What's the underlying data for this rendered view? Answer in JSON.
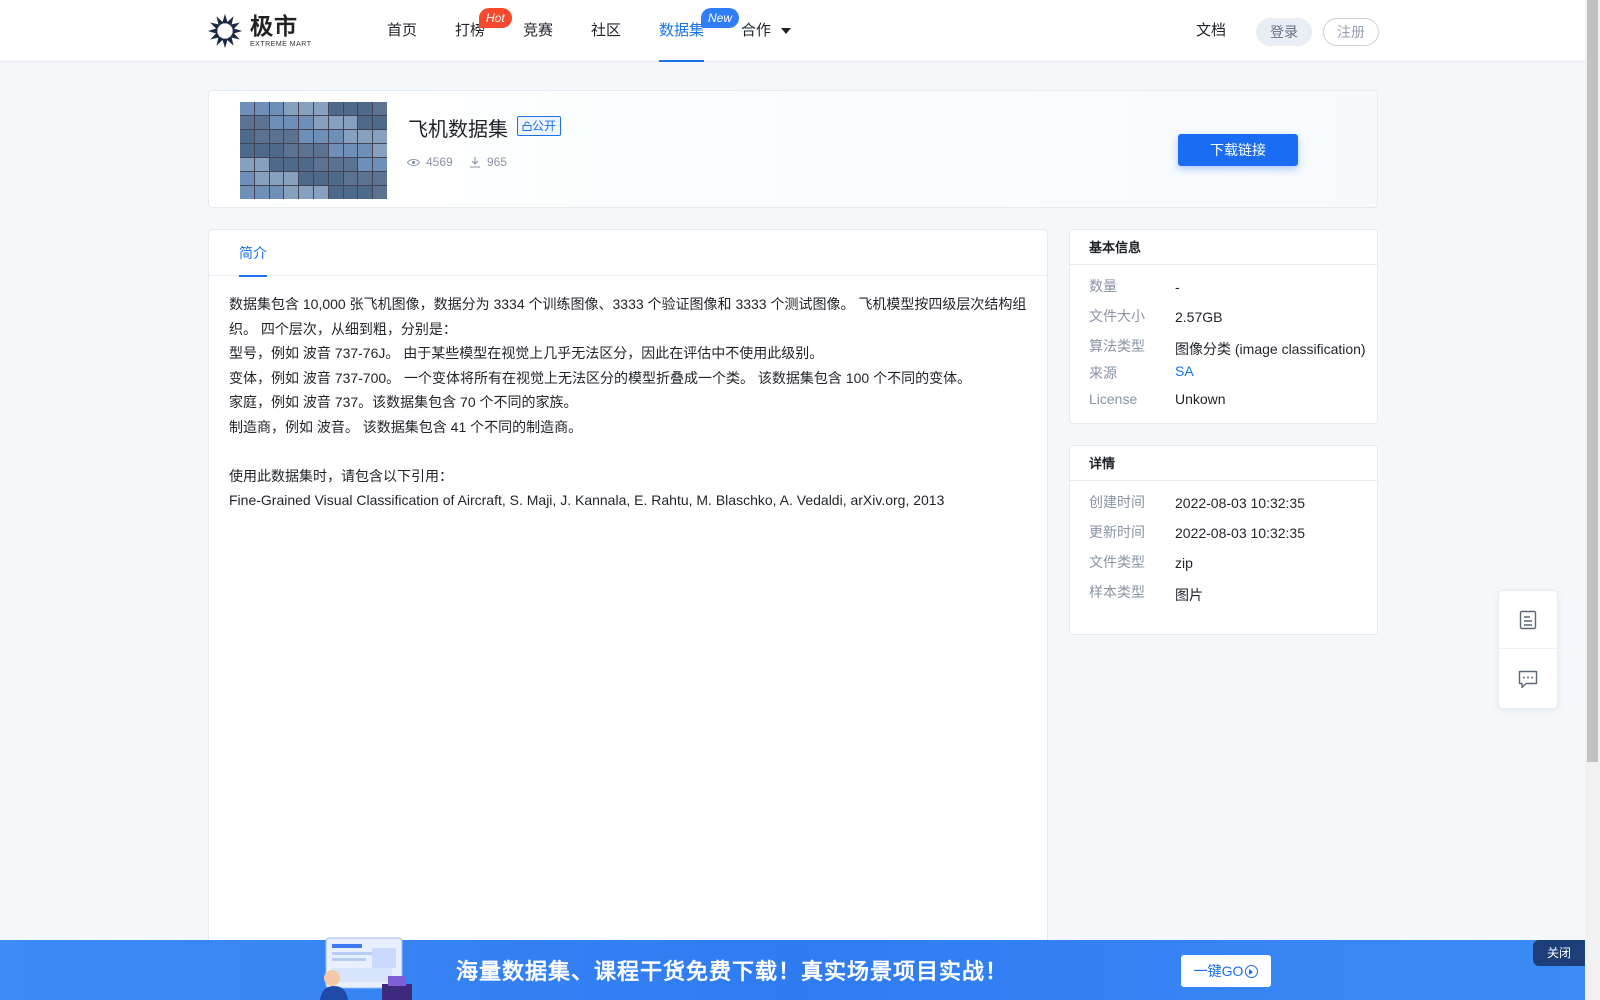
{
  "brand": {
    "name_cn": "极市",
    "name_en": "EXTREME MART"
  },
  "nav": {
    "items": [
      {
        "label": "首页"
      },
      {
        "label": "打榜",
        "badge": "Hot"
      },
      {
        "label": "竞赛"
      },
      {
        "label": "社区"
      },
      {
        "label": "数据集",
        "badge": "New",
        "active": true
      },
      {
        "label": "合作",
        "dropdown": true
      }
    ],
    "docs": "文档",
    "login": "登录",
    "register": "注册"
  },
  "dataset": {
    "title": "飞机数据集",
    "visibility": "公开",
    "views": "4569",
    "downloads": "965",
    "download_button": "下载链接"
  },
  "tabs": [
    {
      "label": "简介",
      "active": true
    }
  ],
  "description": {
    "lines": [
      "数据集包含 10,000 张飞机图像，数据分为 3334 个训练图像、3333 个验证图像和 3333 个测试图像。 飞机模型按四级层次结构组织。 四个层次，从细到粗，分别是：",
      "型号，例如 波音 737-76J。 由于某些模型在视觉上几乎无法区分，因此在评估中不使用此级别。",
      "变体，例如 波音 737-700。 一个变体将所有在视觉上无法区分的模型折叠成一个类。 该数据集包含 100 个不同的变体。",
      "家庭，例如 波音 737。该数据集包含 70 个不同的家族。",
      "制造商，例如 波音。 该数据集包含 41 个不同的制造商。",
      "使用此数据集时，请包含以下引用：",
      "Fine-Grained Visual Classification of Aircraft, S. Maji, J. Kannala, E. Rahtu, M. Blaschko, A. Vedaldi, arXiv.org, 2013"
    ]
  },
  "basic_info": {
    "heading": "基本信息",
    "rows": [
      {
        "key": "数量",
        "value": "-"
      },
      {
        "key": "文件大小",
        "value": "2.57GB"
      },
      {
        "key": "算法类型",
        "value": "图像分类 (image classification)"
      },
      {
        "key": "来源",
        "value": "SA"
      },
      {
        "key": "License",
        "value": "Unkown"
      }
    ]
  },
  "details": {
    "heading": "详情",
    "rows": [
      {
        "key": "创建时间",
        "value": "2022-08-03 10:32:35"
      },
      {
        "key": "更新时间",
        "value": "2022-08-03 10:32:35"
      },
      {
        "key": "文件类型",
        "value": "zip"
      },
      {
        "key": "样本类型",
        "value": "图片"
      }
    ]
  },
  "floating_tools": {
    "icons": [
      "document-icon",
      "message-icon"
    ]
  },
  "promo": {
    "text": "海量数据集、课程干货免费下载！真实场景项目实战！",
    "button": "一键GO",
    "close": "关闭"
  },
  "colors": {
    "accent": "#1a73e8",
    "hot_badge": "#f54a2d",
    "new_badge": "#2f7ef6",
    "promo_bg": "#3d8bf5"
  }
}
